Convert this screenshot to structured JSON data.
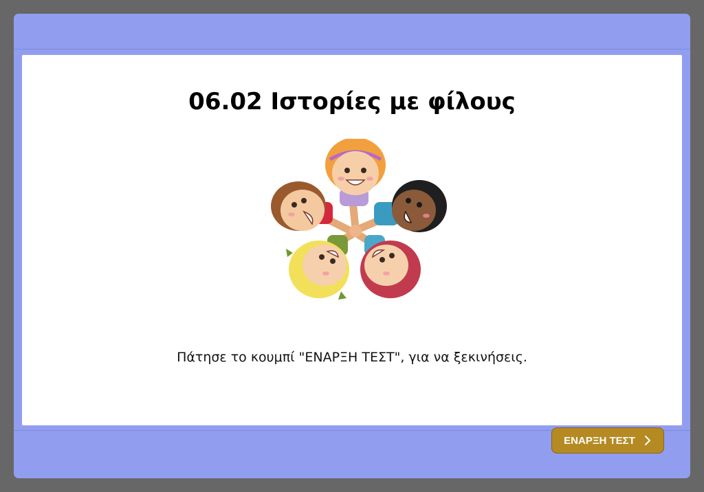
{
  "quiz": {
    "title": "06.02 Ιστορίες με φίλους",
    "instruction": "Πάτησε το κουμπί \"ΕΝΑΡΞΗ ΤΕΣΤ\", για να ξεκινήσεις.",
    "start_button_label": "ΕΝΑΡΞΗ ΤΕΣΤ"
  },
  "illustration": {
    "icon": "children-circle-illustration"
  },
  "colors": {
    "backdrop": "#676767",
    "window": "#919ef0",
    "panel": "#ffffff",
    "button": "#b68a22"
  }
}
